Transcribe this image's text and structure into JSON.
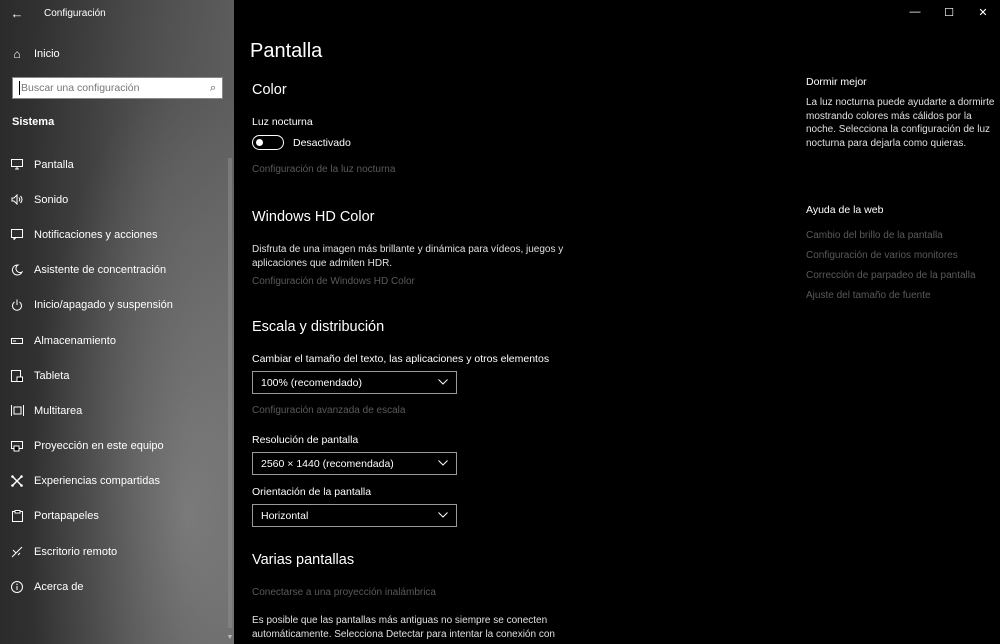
{
  "window": {
    "title": "Configuración"
  },
  "sidebar": {
    "home_label": "Inicio",
    "search_placeholder": "Buscar una configuración",
    "section": "Sistema",
    "items": [
      {
        "label": "Pantalla",
        "icon": "monitor-icon"
      },
      {
        "label": "Sonido",
        "icon": "speaker-icon"
      },
      {
        "label": "Notificaciones y acciones",
        "icon": "notification-icon"
      },
      {
        "label": "Asistente de concentración",
        "icon": "moon-icon"
      },
      {
        "label": "Inicio/apagado y suspensión",
        "icon": "power-icon"
      },
      {
        "label": "Almacenamiento",
        "icon": "storage-icon"
      },
      {
        "label": "Tableta",
        "icon": "tablet-icon"
      },
      {
        "label": "Multitarea",
        "icon": "multitask-icon"
      },
      {
        "label": "Proyección en este equipo",
        "icon": "projection-icon"
      },
      {
        "label": "Experiencias compartidas",
        "icon": "shared-icon"
      },
      {
        "label": "Portapapeles",
        "icon": "clipboard-icon"
      },
      {
        "label": "Escritorio remoto",
        "icon": "remote-icon"
      },
      {
        "label": "Acerca de",
        "icon": "info-icon"
      }
    ]
  },
  "main": {
    "title": "Pantalla",
    "color": {
      "heading": "Color",
      "night_light_label": "Luz nocturna",
      "night_light_state": "Desactivado",
      "night_light_link": "Configuración de la luz nocturna"
    },
    "hdr": {
      "heading": "Windows HD Color",
      "description": "Disfruta de una imagen más brillante y dinámica para vídeos, juegos y aplicaciones que admiten HDR.",
      "link": "Configuración de Windows HD Color"
    },
    "scale": {
      "heading": "Escala y distribución",
      "size_label": "Cambiar el tamaño del texto, las aplicaciones y otros elementos",
      "size_value": "100% (recomendado)",
      "advanced_link": "Configuración avanzada de escala",
      "resolution_label": "Resolución de pantalla",
      "resolution_value": "2560 × 1440 (recomendada)",
      "orientation_label": "Orientación de la pantalla",
      "orientation_value": "Horizontal"
    },
    "multi": {
      "heading": "Varias pantallas",
      "wireless_link": "Conectarse a una proyección inalámbrica",
      "description": "Es posible que las pantallas más antiguas no siempre se conecten automáticamente. Selecciona Detectar para intentar la conexión con"
    }
  },
  "side_panel": {
    "title": "Dormir mejor",
    "text": "La luz nocturna puede ayudarte a dormirte mostrando colores más cálidos por la noche. Selecciona la configuración de luz nocturna para dejarla como quieras.",
    "web_help_title": "Ayuda de la web",
    "links": [
      "Cambio del brillo de la pantalla",
      "Configuración de varios monitores",
      "Corrección de parpadeo de la pantalla",
      "Ajuste del tamaño de fuente"
    ]
  },
  "icons": {
    "back": "←",
    "home": "⌂",
    "search": "⌕",
    "minimize": "—",
    "maximize": "☐",
    "close": "✕",
    "chevron": "⌄"
  }
}
